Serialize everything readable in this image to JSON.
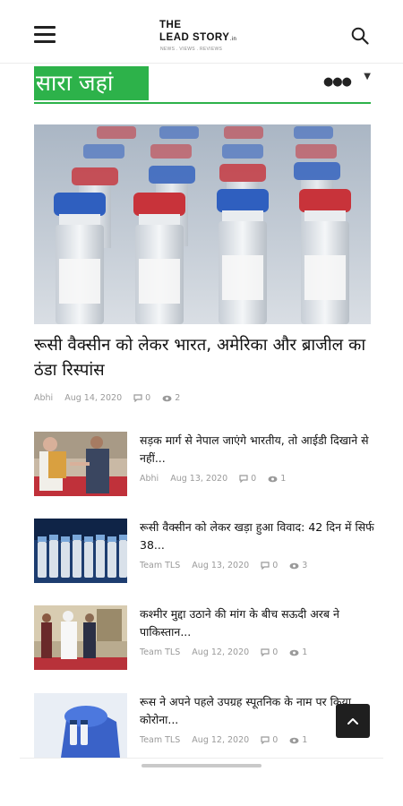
{
  "header": {
    "logo_line1": "THE",
    "logo_line2": "LEAD STORY",
    "logo_suffix": ".in",
    "logo_tagline": "NEWS . VIEWS . REVIEWS"
  },
  "section": {
    "title": "सारा जहां",
    "accent_color": "#2db24a"
  },
  "featured": {
    "title": "रूसी वैक्सीन को लेकर भारत, अमेरिका और ब्राजील का ठंडा रिस्पांस",
    "author": "Abhi",
    "date": "Aug 14, 2020",
    "comments": "0",
    "views": "2"
  },
  "articles": [
    {
      "title": "सड़क मार्ग से नेपाल जाएंगे भारतीय, तो आईडी दिखाने से नहीं...",
      "author": "Abhi",
      "date": "Aug 13, 2020",
      "comments": "0",
      "views": "1"
    },
    {
      "title": "रूसी वैक्सीन को लेकर खड़ा हुआ विवाद: 42 दिन में सिर्फ 38...",
      "author": "Team TLS",
      "date": "Aug 13, 2020",
      "comments": "0",
      "views": "3"
    },
    {
      "title": "कश्मीर मुद्दा उठाने की मांग के बीच सऊदी अरब ने पाकिस्तान...",
      "author": "Team TLS",
      "date": "Aug 12, 2020",
      "comments": "0",
      "views": "1"
    },
    {
      "title": "रूस ने अपने पहले उपग्रह स्पूतनिक के नाम पर किया कोरोना...",
      "author": "Team TLS",
      "date": "Aug 12, 2020",
      "comments": "0",
      "views": "1"
    }
  ],
  "icons": {
    "menu": "hamburger-icon",
    "search": "search-icon",
    "more": "more-dots-icon",
    "comment": "comment-icon",
    "views": "eye-icon",
    "back_to_top": "chevron-up-icon"
  }
}
